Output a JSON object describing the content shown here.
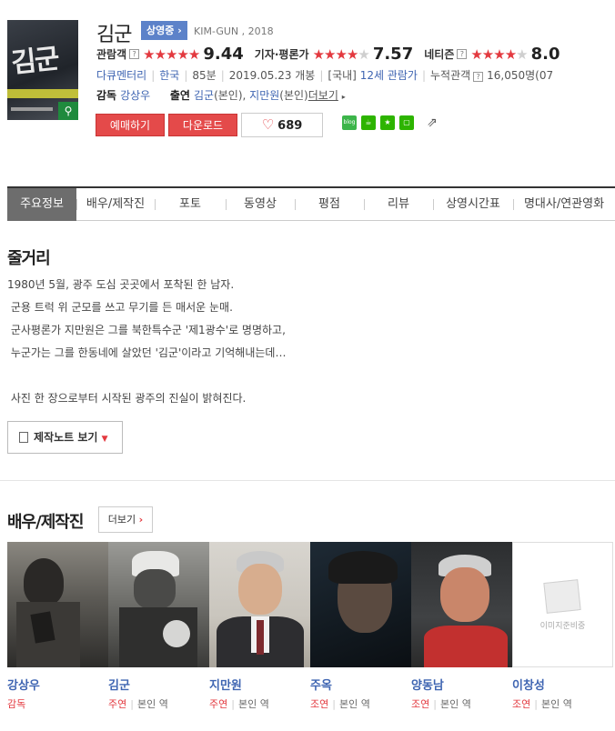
{
  "movie": {
    "title": "김군",
    "status_badge": "상영중",
    "subtitle": "KIM-GUN , 2018",
    "poster_title": "김군"
  },
  "ratings": [
    {
      "label": "관람객",
      "stars": 5,
      "score": "9.44"
    },
    {
      "label": "기자·평론가",
      "stars": 4,
      "score": "7.57"
    },
    {
      "label": "네티즌",
      "stars": 4,
      "score": "8.0"
    }
  ],
  "info": {
    "genre": "다큐멘터리",
    "country": "한국",
    "runtime": "85분",
    "release": "2019.05.23 개봉",
    "grade_prefix": "[국내]",
    "grade": "12세 관람가",
    "audience_label": "누적관객",
    "audience": "16,050명(07"
  },
  "credits": {
    "director_label": "감독",
    "director": "강상우",
    "cast_label": "출연",
    "cast1": "김군",
    "cast1_role": "(본인),",
    "cast2": "지만원",
    "cast2_role": "(본인)",
    "more": "더보기"
  },
  "actions": {
    "reserve": "예매하기",
    "download": "다운로드",
    "likes": "689"
  },
  "share": {
    "blog": "blog",
    "colors": {
      "blog": "#3cb54a",
      "cafe": "#2db400",
      "star": "#2db400",
      "square": "#2db400"
    }
  },
  "tabs": [
    "주요정보",
    "배우/제작진",
    "포토",
    "동영상",
    "평점",
    "리뷰",
    "상영시간표",
    "명대사/연관영화"
  ],
  "synopsis": {
    "heading": "줄거리",
    "lines": [
      "1980년 5월, 광주 도심 곳곳에서 포착된 한 남자.",
      " 군용 트럭 위 군모를 쓰고 무기를 든 매서운 눈매.",
      " 군사평론가 지만원은 그를 북한특수군 '제1광수'로 명명하고,",
      " 누군가는 그를 한동네에 살았던 '김군'이라고 기억해내는데…",
      "",
      " 사진 한 장으로부터 시작된 광주의 진실이 밝혀진다."
    ],
    "note_button": "제작노트 보기"
  },
  "cast_section": {
    "heading": "배우/제작진",
    "more": "더보기",
    "no_image": "이미지준비중",
    "members": [
      {
        "name": "강상우",
        "role": "감독",
        "part": ""
      },
      {
        "name": "김군",
        "role": "주연",
        "part": "본인 역"
      },
      {
        "name": "지만원",
        "role": "주연",
        "part": "본인 역"
      },
      {
        "name": "주옥",
        "role": "조연",
        "part": "본인 역"
      },
      {
        "name": "양동남",
        "role": "조연",
        "part": "본인 역"
      },
      {
        "name": "이창성",
        "role": "조연",
        "part": "본인 역"
      }
    ]
  }
}
